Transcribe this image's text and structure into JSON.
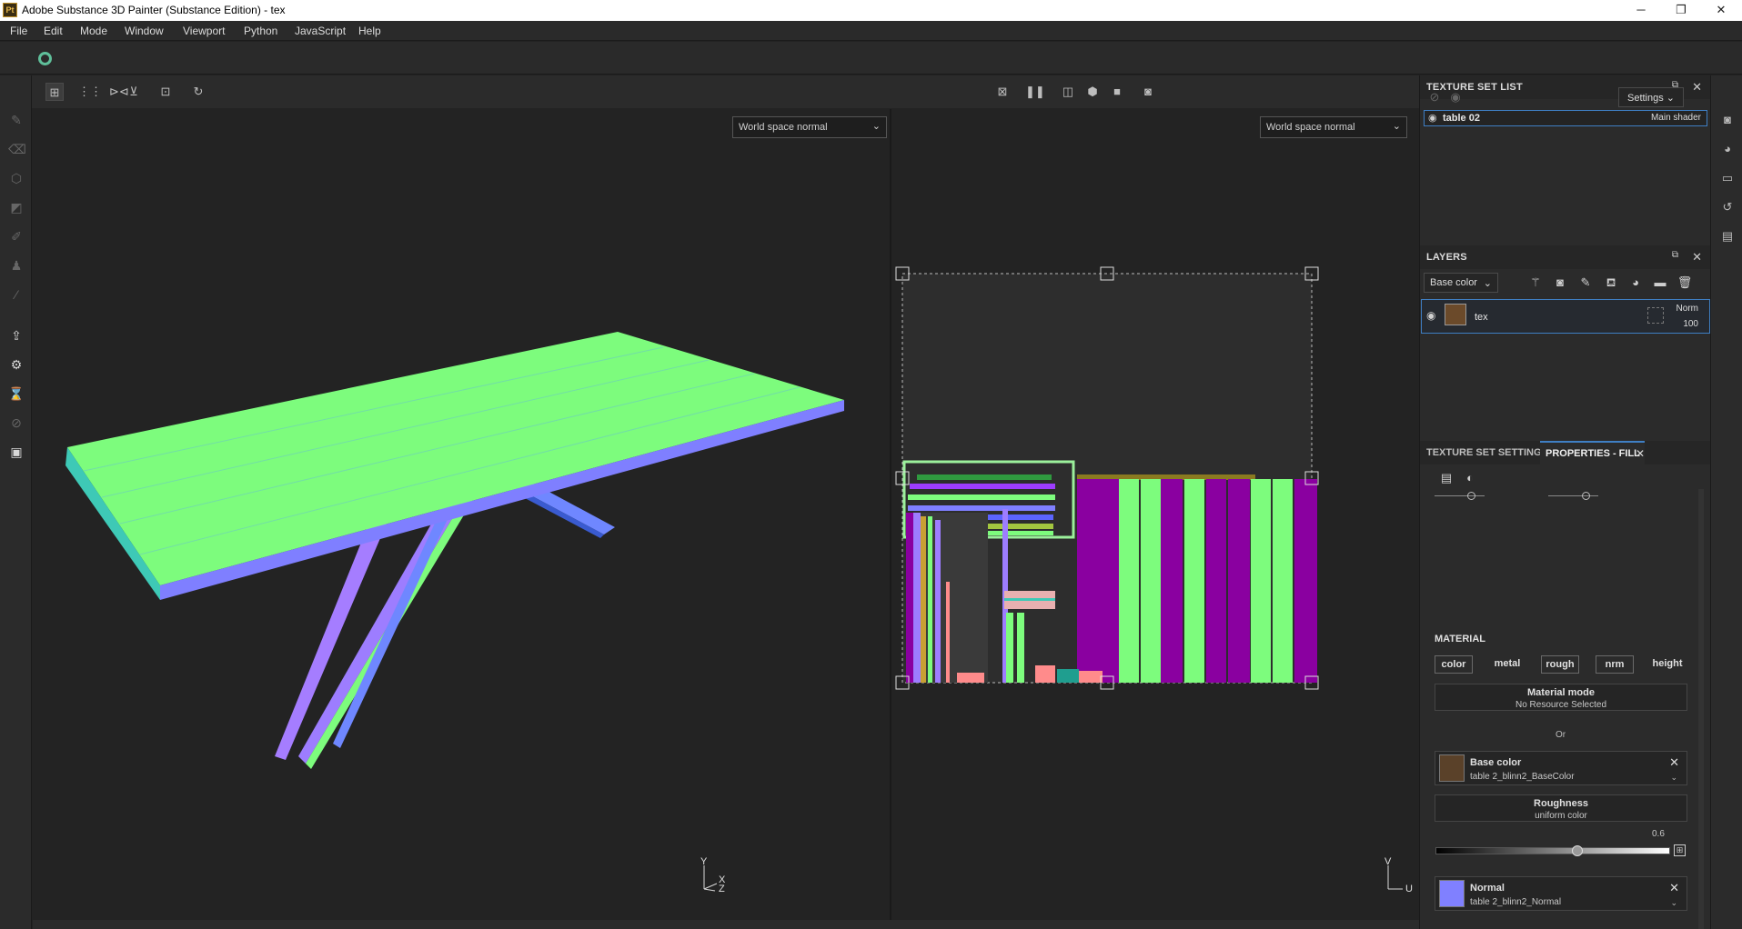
{
  "window": {
    "title": "Adobe Substance 3D Painter (Substance Edition) - tex",
    "app_icon": "Pt",
    "controls": {
      "minimize": "─",
      "maximize": "❐",
      "close": "✕"
    }
  },
  "menu": [
    "File",
    "Edit",
    "Mode",
    "Window",
    "Viewport",
    "Python",
    "JavaScript",
    "Help"
  ],
  "viewport": {
    "left_mode": "World space normal",
    "right_mode": "World space normal",
    "axis_3d": {
      "y": "Y",
      "x": "X",
      "z": "Z"
    },
    "axis_2d": {
      "v": "V",
      "u": "U"
    }
  },
  "texture_set_list": {
    "title": "TEXTURE SET LIST",
    "settings_label": "Settings",
    "item": {
      "name": "table 02",
      "shader": "Main shader"
    }
  },
  "layers": {
    "title": "LAYERS",
    "channel": "Base color",
    "layer": {
      "name": "tex",
      "blend": "Norm",
      "opacity": "100"
    }
  },
  "properties": {
    "tab_inactive": "TEXTURE SET SETTINGS",
    "tab_active": "PROPERTIES - FILL",
    "material_heading": "MATERIAL",
    "channels": [
      "color",
      "metal",
      "rough",
      "nrm",
      "height"
    ],
    "material_mode": {
      "title": "Material mode",
      "value": "No Resource Selected"
    },
    "or_label": "Or",
    "base_color": {
      "title": "Base color",
      "value": "table 2_blinn2_BaseColor"
    },
    "roughness": {
      "title": "Roughness",
      "value": "uniform color",
      "amount": "0.6",
      "fraction": 0.6
    },
    "normal": {
      "title": "Normal",
      "value": "table 2_blinn2_Normal",
      "swatch": "#8080ff"
    }
  },
  "colors": {
    "accent_blue": "#3f7fc4",
    "normal_green": "#7dfc7d",
    "normal_blue": "#7f7fff",
    "normal_purple": "#8a00a0",
    "bg_dark": "#232323",
    "panel": "#2b2b2b"
  }
}
